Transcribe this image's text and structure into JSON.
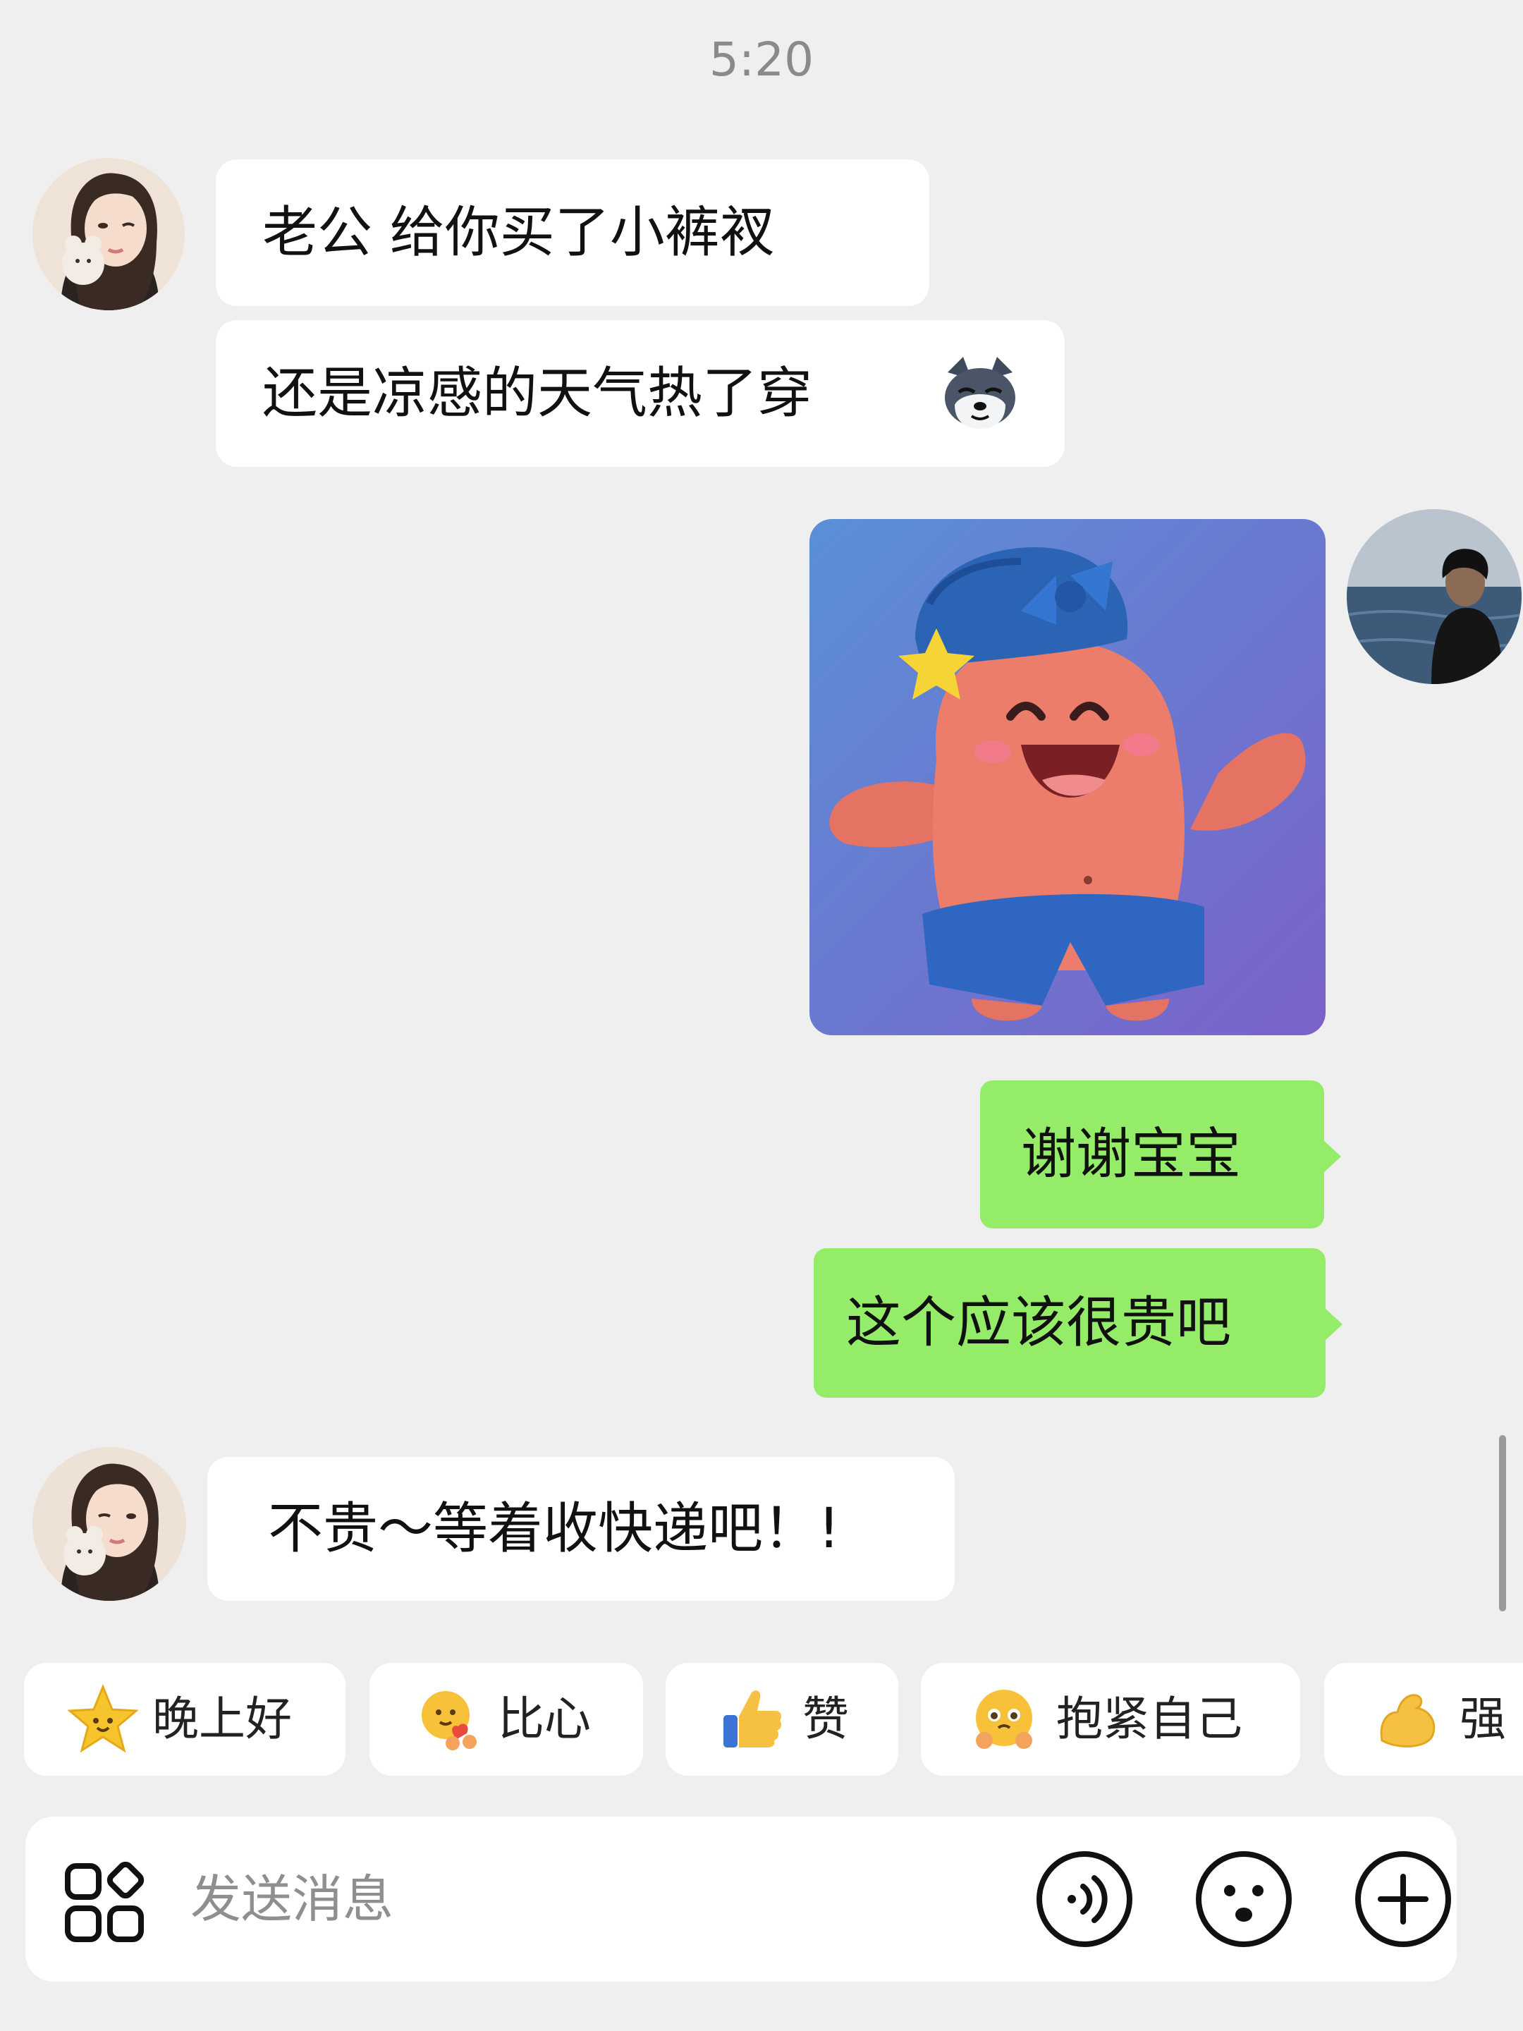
{
  "status": {
    "time": "5:20"
  },
  "messages": [
    {
      "sender": "friend",
      "type": "text",
      "text": "老公 给你买了小裤衩"
    },
    {
      "sender": "friend",
      "type": "text",
      "text": "还是凉感的天气热了穿",
      "trailing_emoji": "husky-dog-emoji"
    },
    {
      "sender": "me",
      "type": "sticker",
      "sticker": "patrick-star-happy-sticker"
    },
    {
      "sender": "me",
      "type": "text",
      "text": "谢谢宝宝"
    },
    {
      "sender": "me",
      "type": "text",
      "text": "这个应该很贵吧"
    },
    {
      "sender": "friend",
      "type": "text",
      "text": "不贵～等着收快递吧！!"
    }
  ],
  "quick_replies": [
    {
      "label": "晚上好",
      "icon": "star-face-emoji"
    },
    {
      "label": "比心",
      "icon": "heart-hands-emoji"
    },
    {
      "label": "赞",
      "icon": "thumbs-up-emoji"
    },
    {
      "label": "抱紧自己",
      "icon": "hugging-face-emoji"
    },
    {
      "label": "强",
      "icon": "flexed-biceps-emoji"
    }
  ],
  "input": {
    "placeholder": "发送消息"
  },
  "colors": {
    "background": "#efefef",
    "my_bubble": "#95ec69",
    "friend_bubble": "#ffffff"
  }
}
